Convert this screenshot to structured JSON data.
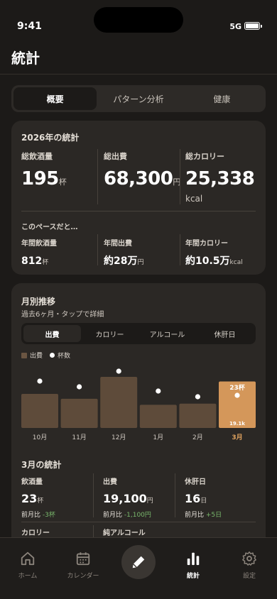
{
  "status": {
    "time": "9:41",
    "network": "5G"
  },
  "page": {
    "title": "統計"
  },
  "tabs": [
    "概要",
    "パターン分析",
    "健康"
  ],
  "year_card": {
    "title": "2026年の統計",
    "drinks_label": "総飲酒量",
    "drinks_value": "195",
    "drinks_unit": "杯",
    "spend_label": "総出費",
    "spend_value": "68,300",
    "spend_unit": "円",
    "cal_label": "総カロリー",
    "cal_value": "25,338",
    "cal_unit": "kcal",
    "pace_title": "このペースだと…",
    "annual_drinks_label": "年間飲酒量",
    "annual_drinks_value": "812",
    "annual_drinks_unit": "杯",
    "annual_spend_label": "年間出費",
    "annual_spend_value": "約28万",
    "annual_spend_unit": "円",
    "annual_cal_label": "年間カロリー",
    "annual_cal_value": "約10.5万",
    "annual_cal_unit": "kcal"
  },
  "month_card": {
    "title": "月別推移",
    "subtitle": "過去6ヶ月・タップで詳細",
    "metric_tabs": [
      "出費",
      "カロリー",
      "アルコール",
      "休肝日"
    ],
    "legend_spend": "出費",
    "legend_cups": "杯数",
    "detail_title": "3月の統計",
    "drinks_label": "飲酒量",
    "drinks_value": "23",
    "drinks_unit": "杯",
    "drinks_delta_prefix": "前月比",
    "drinks_delta": "-3杯",
    "spend_label": "出費",
    "spend_value": "19,100",
    "spend_unit": "円",
    "spend_delta_prefix": "前月比",
    "spend_delta": "-1,100円",
    "rest_label": "休肝日",
    "rest_value": "16",
    "rest_unit": "日",
    "rest_delta_prefix": "前月比",
    "rest_delta": "+5日",
    "cal_label": "カロリー",
    "alcohol_label": "純アルコール"
  },
  "chart_data": {
    "type": "bar",
    "categories": [
      "10月",
      "11月",
      "12月",
      "1月",
      "2月",
      "3月"
    ],
    "series": [
      {
        "name": "出費",
        "values": [
          14000,
          12000,
          21000,
          9500,
          10000,
          19100
        ]
      },
      {
        "name": "杯数",
        "values": [
          33,
          29,
          40,
          26,
          22,
          23
        ]
      }
    ],
    "highlight_index": 5,
    "highlight_bar_label": "19.1k",
    "highlight_point_label": "23杯"
  },
  "nav": {
    "home": "ホーム",
    "calendar": "カレンダー",
    "stats": "統計",
    "settings": "設定"
  },
  "colors": {
    "bar": "#5e4b3a",
    "bar_highlight": "#d4975a",
    "highlight_label": "#e0a35f",
    "positive": "#79b86c"
  }
}
